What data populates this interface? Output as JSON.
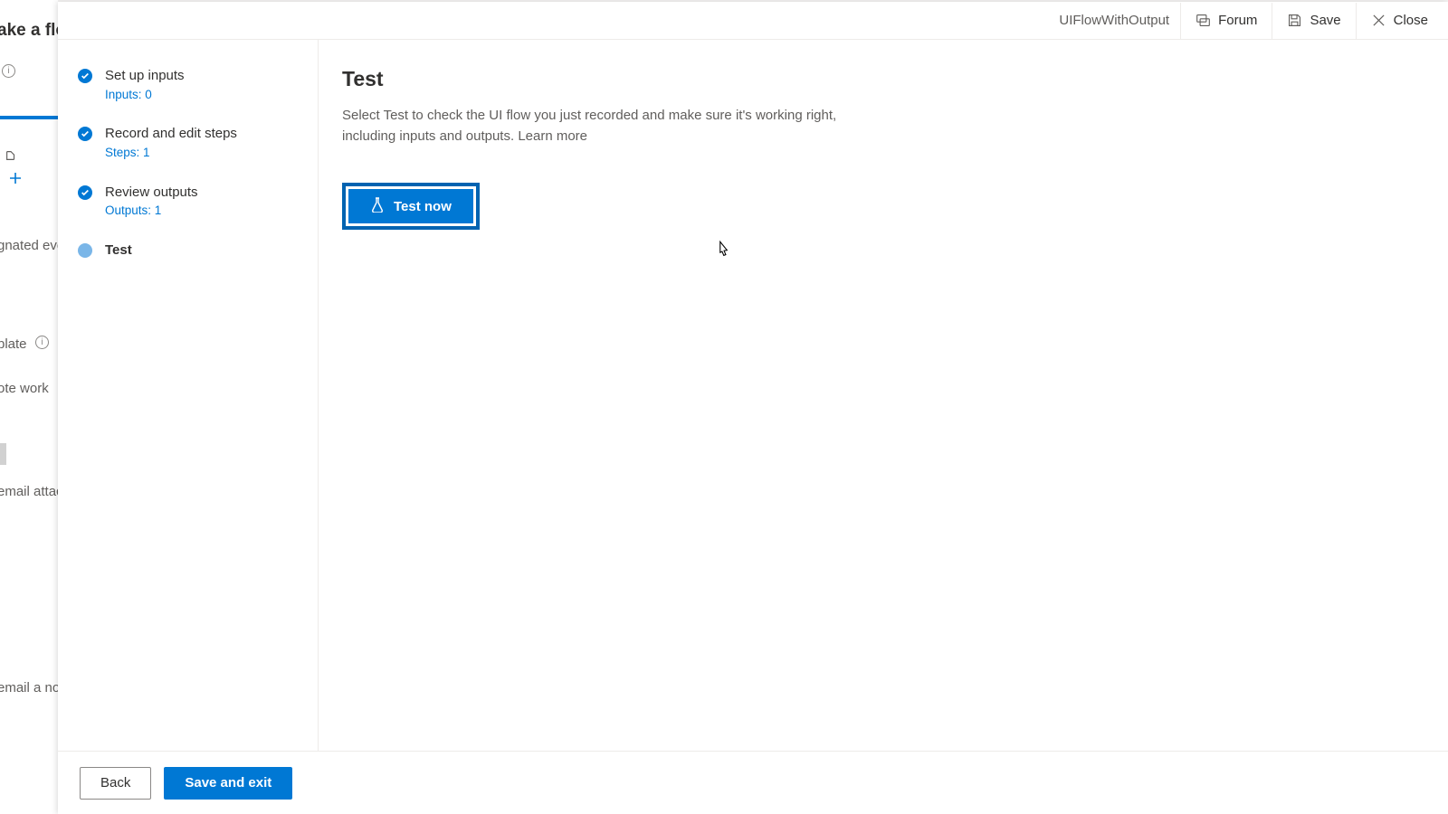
{
  "header": {
    "flow_name": "UIFlowWithOutput",
    "forum_label": "Forum",
    "save_label": "Save",
    "close_label": "Close"
  },
  "steps": [
    {
      "label": "Set up inputs",
      "sub": "Inputs: 0",
      "state": "complete"
    },
    {
      "label": "Record and edit steps",
      "sub": "Steps: 1",
      "state": "complete"
    },
    {
      "label": "Review outputs",
      "sub": "Outputs: 1",
      "state": "complete"
    },
    {
      "label": "Test",
      "sub": "",
      "state": "current"
    }
  ],
  "page": {
    "title": "Test",
    "description": "Select Test to check the UI flow you just recorded and make sure it's working right, including inputs and outputs. ",
    "learn_more": "Learn more",
    "test_now_label": "Test now"
  },
  "footer": {
    "back_label": "Back",
    "save_exit_label": "Save and exit"
  },
  "background": {
    "title_fragment": "ake a flo",
    "fragments": [
      "gnated even",
      "plate",
      "ote work",
      "email attac",
      "email a no"
    ]
  }
}
